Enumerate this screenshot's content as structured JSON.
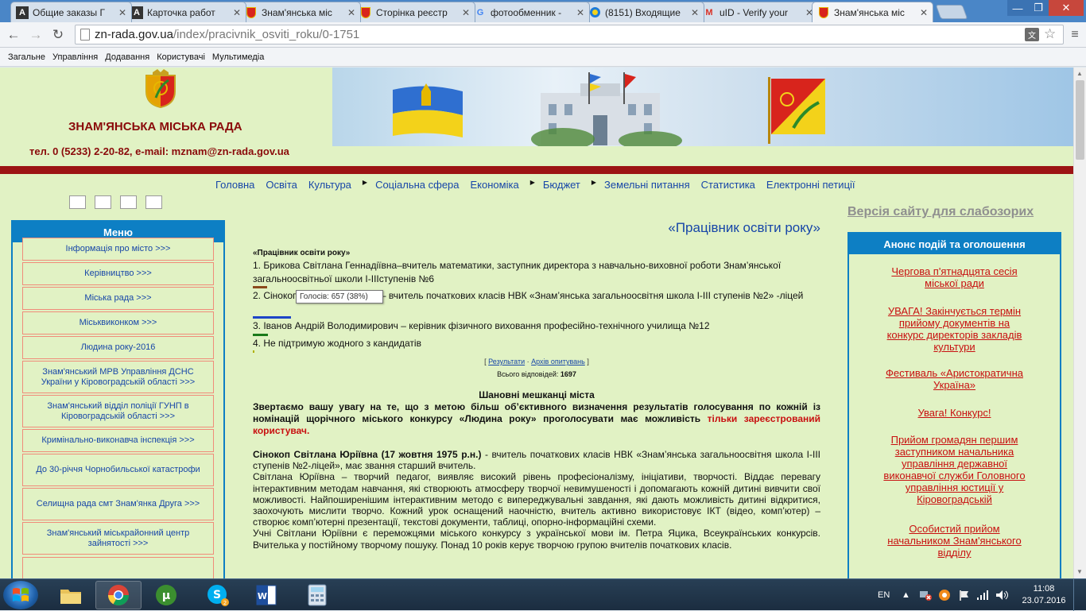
{
  "browser": {
    "tabs": [
      {
        "label": "Общие заказы Г",
        "icon": "A"
      },
      {
        "label": "Карточка работ",
        "icon": "A"
      },
      {
        "label": "Знам'янська міс",
        "icon": "crest"
      },
      {
        "label": "Сторінка реєстр",
        "icon": "crest"
      },
      {
        "label": "фотообменник -",
        "icon": "G"
      },
      {
        "label": "(8151) Входящие",
        "icon": "ring"
      },
      {
        "label": "uID - Verify your",
        "icon": "M"
      },
      {
        "label": "Знам'янська міс",
        "icon": "crest",
        "active": true
      }
    ],
    "url_host": "zn-rada.gov.ua",
    "url_path": "/index/pracivnik_osviti_roku/0-1751",
    "bookmarks": [
      "Загальне",
      "Управління",
      "Додавання",
      "Користувачі",
      "Мультимедіа"
    ]
  },
  "site": {
    "title": "ЗНАМ'ЯНСЬКА МІСЬКА РАДА",
    "contact": "тел. 0 (5233) 2-20-82, e-mail: mznam@zn-rada.gov.ua",
    "nav": [
      {
        "label": "Головна",
        "arrow": false
      },
      {
        "label": "Освіта",
        "arrow": false
      },
      {
        "label": "Культура",
        "arrow": true
      },
      {
        "label": "Соціальна сфера",
        "arrow": false
      },
      {
        "label": "Економіка",
        "arrow": true
      },
      {
        "label": "Бюджет",
        "arrow": true
      },
      {
        "label": "Земельні питання",
        "arrow": false
      },
      {
        "label": "Статистика",
        "arrow": false
      },
      {
        "label": "Електронні петиції",
        "arrow": false
      }
    ]
  },
  "menu": {
    "title": "Меню",
    "items": [
      "Інформація про місто >>>",
      "Керівництво >>>",
      "Міська рада >>>",
      "Міськвиконком >>>",
      "Людина року-2016",
      "Знам'янський МРВ Управління ДСНС України у Кіровоградській області >>>",
      "Знам'янський відділ поліції ГУНП в Кіровоградській області >>>",
      "Кримінально-виконавча інспекція >>>",
      "До 30-річчя Чорнобильської катастрофи",
      "Селищна рада смт Знам'янка Друга >>>",
      "Знам'янський міськрайонний центр зайнятості >>>"
    ]
  },
  "main": {
    "heading": "«Працівник освіти року»",
    "poll_title": "«Працівник освіти року»",
    "options": [
      {
        "text": "1. Брикова Світлана Геннадіївна–вчитель математики, заступник директора з навчально-виховної роботи Знам’янської загальноосвітньої школи І-ІІІступенів №6",
        "bar_color": "#8b4a1c",
        "share": 0.14
      },
      {
        "text": "2. Сінокоп Світлана Юріївна – вчитель початкових класів НВК «Знам’янська загальноосвітня школа І-ІІІ ступенів №2» -ліцей",
        "bar_color": "#1d45c8",
        "share": 0.38
      },
      {
        "text": "3. Іванов Андрій Володимирович – керівник фізичного виховання професійно-технічного училища №12",
        "bar_color": "#1a7a1a",
        "share": 0.15
      },
      {
        "text": "4. Не підтримую жодного з кандидатів",
        "bar_color": "#b0b000",
        "share": 0.01
      }
    ],
    "tooltip": "Голосів: 657 (38%)",
    "results_link": "Результати",
    "archive_link": "Архів опитувань",
    "total_label": "Всього відповідей:",
    "total_value": "1697",
    "notice_heading": "Шановні мешканці міста",
    "notice_text": "Звертаємо вашу увагу на те, що з метою більш об’єктивного визначення результатів голосування по кожній із номінацій щорічного міського конкурсу «Людина року» проголосувати має можливість ",
    "notice_red": "тільки зареєстрований користувач.",
    "bio_name": "Сінокоп Світлана Юріївна (17 жовтня 1975 р.н.)",
    "bio_intro": " - вчитель початкових класів НВК «Знам’янська загальноосвітня школа І-ІІІ ступенів №2-ліцей», має звання старший вчитель.",
    "bio_p2": "Світлана Юріївна – творчий педагог, виявляє високий рівень професіоналізму, ініціативи, творчості. Віддає перевагу інтерактивним методам навчання, які створюють атмосферу творчої невимушеності і допомагають кожній дитині вивчити свої можливості. Найпоширенішим інтерактивним методо є випереджувальні завдання, які дають можливість дитині відкритися, заохочують мислити творчо. Кожний урок оснащений наочністю, вчитель активно використовує ІКТ (відео, комп’ютер) – створює комп’ютерні презентації, текстові документи, таблиці, опорно-інформаційні схеми.",
    "bio_p3": "Учні Світлани Юріївни є переможцями міського конкурсу з української мови ім. Петра Яцика, Всеукраїнських конкурсів. Вчителька у постійному творчому пошуку. Понад 10 років керує творчою групою вчителів початкових класів."
  },
  "sidebar_right": {
    "weak_vision_link": "Версія сайту для слабозорих",
    "announce_title": "Анонс подій та оголошення",
    "items": [
      "Чергова п'ятнадцята сесія міської ради",
      "УВАГА! Закінчується термін прийому документів на конкурс директорів закладів культури",
      "Фестиваль «Аристократична Україна»",
      "Увага! Конкурс!",
      "Прийом громадян першим заступником начальника управління державної виконавчої служби Головного управління юстиції у Кіровоградській",
      "Особистий прийом начальником Знам'янського відділу"
    ]
  },
  "taskbar": {
    "lang": "EN",
    "time": "11:08",
    "date": "23.07.2016"
  },
  "colors": {
    "page_bg": "#e1f2c4",
    "menu_blue": "#0d7fc4",
    "dark_red": "#9c1414",
    "link_blue": "#1746a8",
    "alert_red": "#c81010"
  }
}
